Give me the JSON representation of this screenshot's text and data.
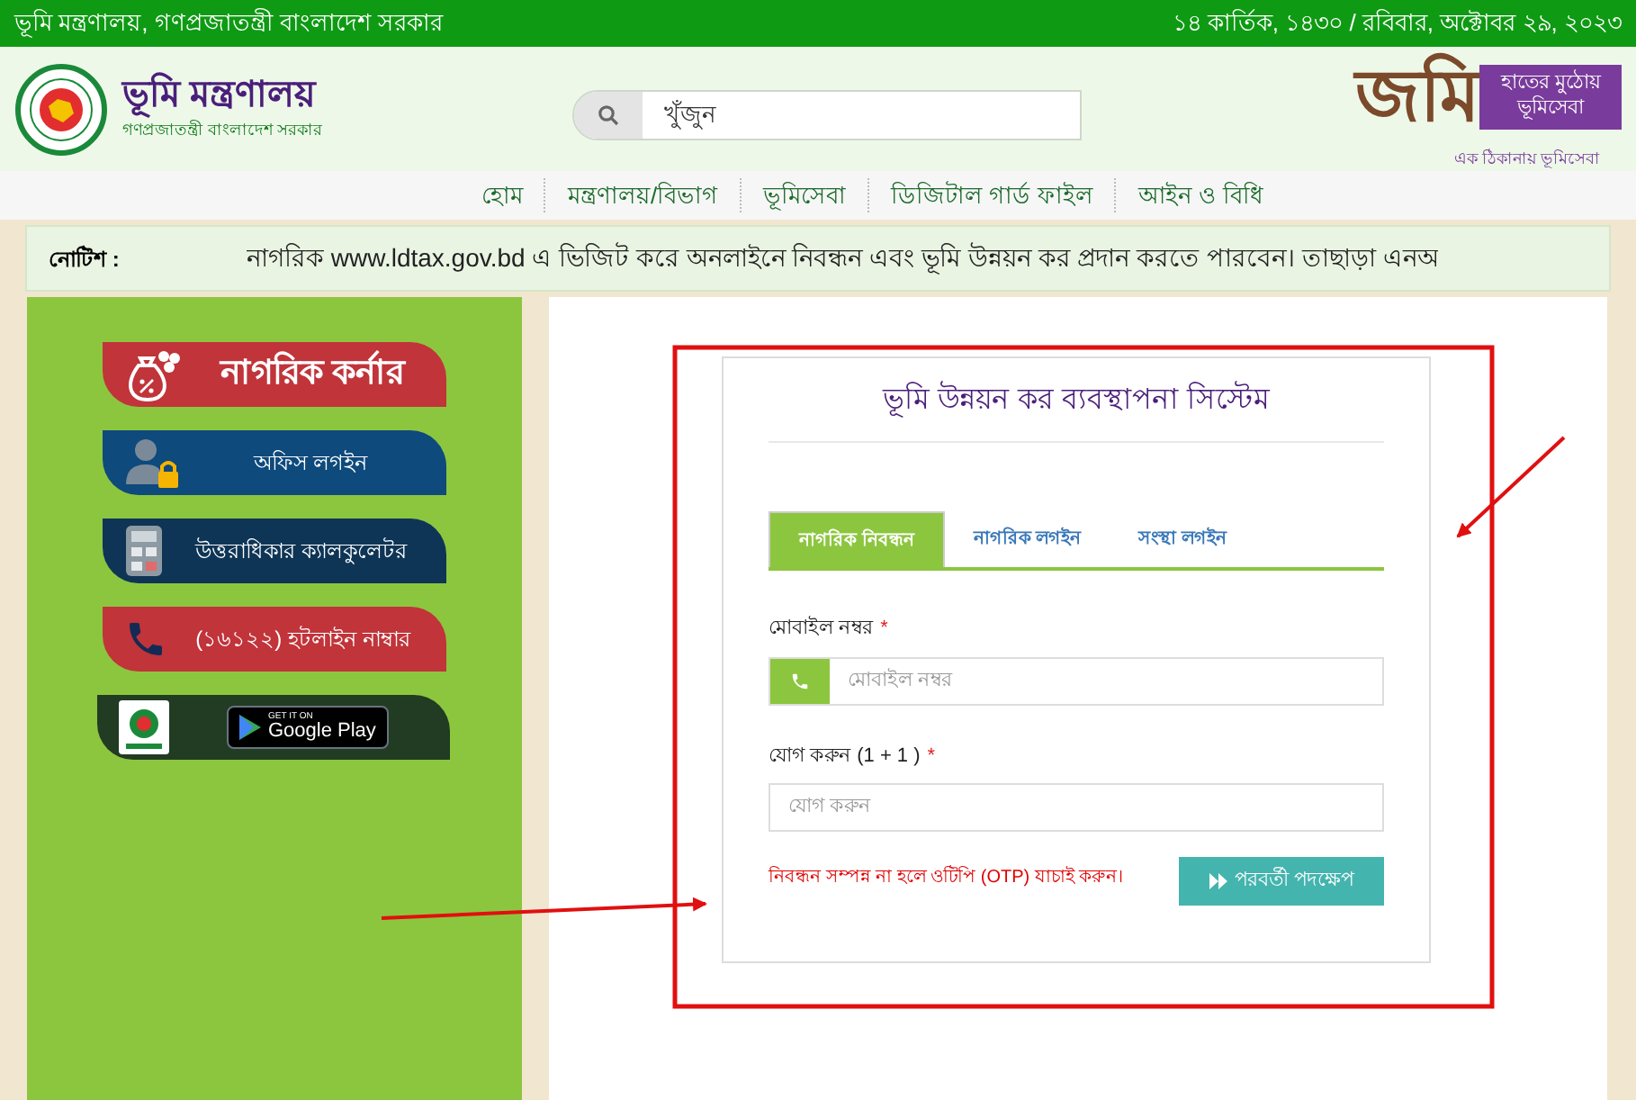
{
  "top_bar": {
    "title": "ভূমি মন্ত্রণালয়, গণপ্রজাতন্ত্রী বাংলাদেশ সরকার",
    "date": "১৪ কার্তিক, ১৪৩০ / রবিবার, অক্টোবর ২৯, ২০২৩"
  },
  "header": {
    "ministry_name": "ভূমি মন্ত্রণালয়",
    "ministry_subtitle": "গণপ্রজাতন্ত্রী বাংলাদেশ সরকার",
    "search": {
      "placeholder": "খুঁজুন"
    },
    "brand": {
      "logo_text": "জমি",
      "tagline_lines": [
        "হাতের মুঠোয়",
        "ভূমিসেবা"
      ],
      "slogan": "এক ঠিকানায় ভূমিসেবা"
    }
  },
  "nav": {
    "items": [
      {
        "label": "হোম"
      },
      {
        "label": "মন্ত্রণালয়/বিভাগ"
      },
      {
        "label": "ভূমিসেবা"
      },
      {
        "label": "ডিজিটাল গার্ড ফাইল"
      },
      {
        "label": "আইন ও বিধি"
      }
    ]
  },
  "notice": {
    "label": "নোটিশ :",
    "text": "নাগরিক www.ldtax.gov.bd এ ভিজিট করে অনলাইনে নিবন্ধন এবং ভূমি উন্নয়ন কর প্রদান করতে পারবেন। তাছাড়া এনঅ"
  },
  "sidebar": {
    "items": [
      {
        "kind": "citizen_corner",
        "label": "নাগরিক কর্নার",
        "color": "#c0343a"
      },
      {
        "kind": "office_login",
        "label": "অফিস লগইন",
        "color": "#0e4a7c"
      },
      {
        "kind": "calculator",
        "label": "উত্তরাধিকার ক্যালকুলেটর",
        "color": "#0e3556"
      },
      {
        "kind": "hotline",
        "label": "(১৬১২২) হটলাইন নাম্বার",
        "color": "#c0343a"
      },
      {
        "kind": "app_download",
        "badge_small": "GET IT ON",
        "badge_large": "Google Play",
        "color": "#213c22"
      }
    ]
  },
  "form": {
    "title": "ভূমি উন্নয়ন কর ব্যবস্থাপনা সিস্টেম",
    "tabs": [
      {
        "label": "নাগরিক নিবন্ধন",
        "selected": true
      },
      {
        "label": "নাগরিক লগইন",
        "selected": false
      },
      {
        "label": "সংস্থা লগইন",
        "selected": false
      }
    ],
    "fields": [
      {
        "kind": "phone",
        "label": "মোবাইল নম্বর",
        "required_mark": "*",
        "placeholder": "মোবাইল নম্বর"
      },
      {
        "kind": "plain",
        "label": "যোগ করুন (1 + 1 )",
        "required_mark": "*",
        "placeholder": "যোগ করুন"
      }
    ],
    "note": "নিবন্ধন সম্পন্ন না হলে ওটিপি (OTP) যাচাই করুন।",
    "next_button": "পরবর্তী পদক্ষেপ"
  }
}
